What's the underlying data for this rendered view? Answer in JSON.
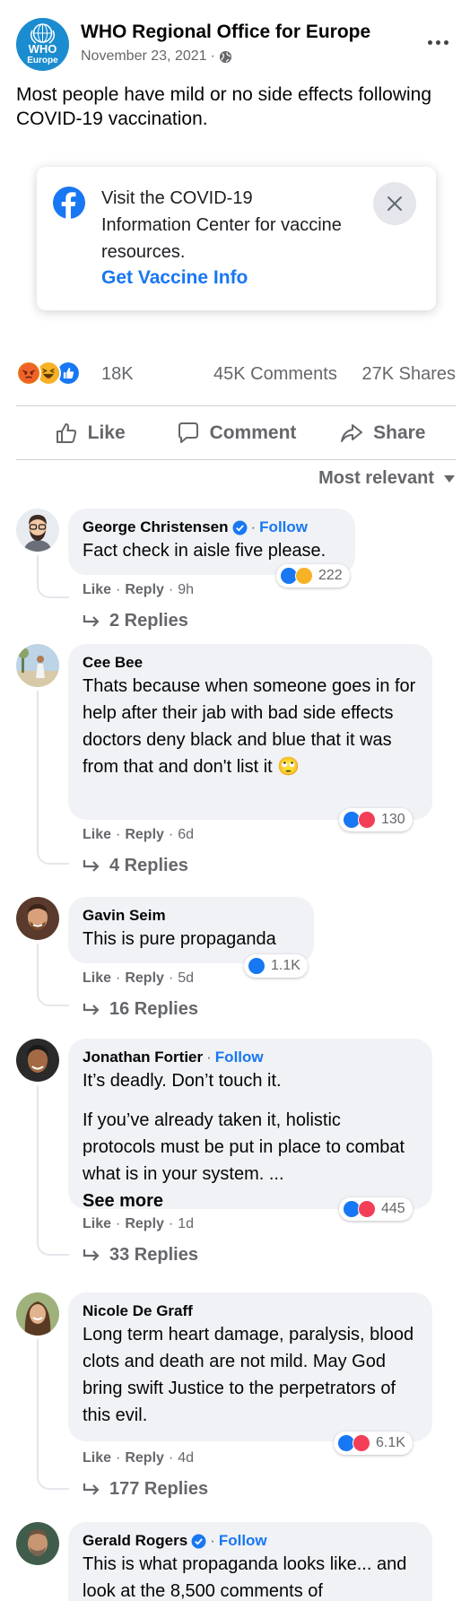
{
  "post": {
    "page_name": "WHO Regional Office for Europe",
    "avatar_text_top": "WHO",
    "avatar_text_bottom": "Europe",
    "date": "November 23, 2021",
    "dot": "·",
    "privacy_icon": "globe-icon",
    "text": "Most people have mild or no side effects following COVID-19 vaccination."
  },
  "info_card": {
    "text": "Visit the COVID-19 Information Center for vaccine resources.",
    "link": "Get Vaccine Info",
    "icon": "facebook-icon"
  },
  "stats": {
    "reactions": "18K",
    "comments": "45K Comments",
    "shares": "27K Shares",
    "reaction_icons": [
      "angry-icon",
      "haha-icon",
      "like-icon"
    ]
  },
  "actions": {
    "like": "Like",
    "comment": "Comment",
    "share": "Share"
  },
  "sort_label": "Most relevant",
  "comments": [
    {
      "author": "George Christensen",
      "verified": true,
      "follow": "Follow",
      "text": "Fact check in aisle five please.",
      "like": "Like",
      "reply": "Reply",
      "time": "9h",
      "reactions": "222",
      "reaction_icons": [
        "like-icon",
        "haha-icon"
      ],
      "replies": "2 Replies"
    },
    {
      "author": "Cee Bee",
      "text": "Thats because when someone goes in for help after their jab with bad side effects doctors deny black and blue that it was from that and don't list it 🙄",
      "like": "Like",
      "reply": "Reply",
      "time": "6d",
      "reactions": "130",
      "reaction_icons": [
        "like-icon",
        "love-icon"
      ],
      "replies": "4 Replies"
    },
    {
      "author": "Gavin Seim",
      "text": "This is pure propaganda",
      "like": "Like",
      "reply": "Reply",
      "time": "5d",
      "reactions": "1.1K",
      "reaction_icons": [
        "like-icon"
      ],
      "replies": "16 Replies"
    },
    {
      "author": "Jonathan Fortier",
      "follow": "Follow",
      "text": "It’s deadly. Don’t touch it.",
      "text2": "If you’ve already taken it, holistic protocols must be put in place to combat what is in your system. ...",
      "see_more": "See more",
      "like": "Like",
      "reply": "Reply",
      "time": "1d",
      "reactions": "445",
      "reaction_icons": [
        "like-icon",
        "love-icon"
      ],
      "replies": "33 Replies"
    },
    {
      "author": "Nicole De Graff",
      "text": "Long term heart damage, paralysis, blood clots and death are not mild. May God bring swift Justice to the perpetrators of this evil.",
      "like": "Like",
      "reply": "Reply",
      "time": "4d",
      "reactions": "6.1K",
      "reaction_icons": [
        "like-icon",
        "love-icon"
      ],
      "replies": "177 Replies"
    },
    {
      "author": "Gerald Rogers",
      "verified": true,
      "follow": "Follow",
      "text": "This is what propaganda looks like... and look at the 8,500 comments of"
    }
  ],
  "colors": {
    "brand_blue": "#1877f2",
    "who_blue": "#1b8ccf",
    "secondary_text": "#65676b",
    "bubble_bg": "#f0f2f5"
  }
}
